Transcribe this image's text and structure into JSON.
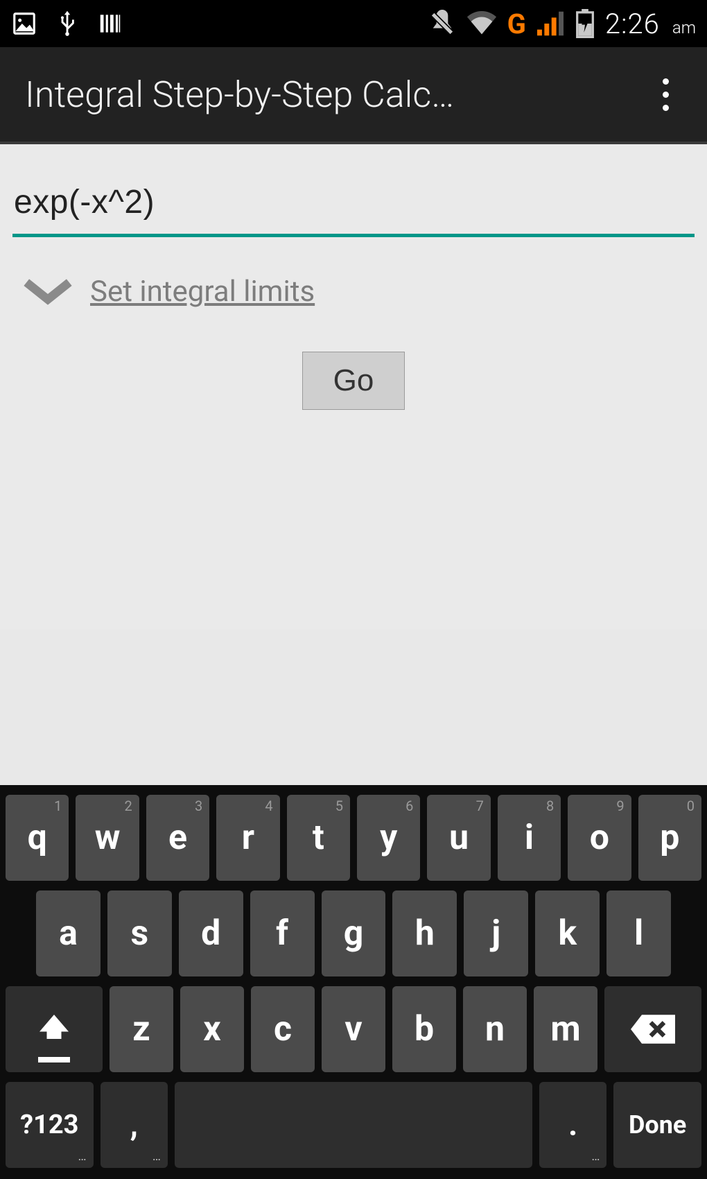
{
  "status": {
    "network_label": "G",
    "time": "2:26",
    "ampm": "am"
  },
  "app": {
    "title": "Integral Step-by-Step Calc…"
  },
  "main": {
    "input_value": "exp(-x^2)",
    "limits_label": "Set integral limits",
    "go_label": "Go"
  },
  "keyboard": {
    "row1": [
      {
        "main": "q",
        "hint": "1"
      },
      {
        "main": "w",
        "hint": "2"
      },
      {
        "main": "e",
        "hint": "3"
      },
      {
        "main": "r",
        "hint": "4"
      },
      {
        "main": "t",
        "hint": "5"
      },
      {
        "main": "y",
        "hint": "6"
      },
      {
        "main": "u",
        "hint": "7"
      },
      {
        "main": "i",
        "hint": "8"
      },
      {
        "main": "o",
        "hint": "9"
      },
      {
        "main": "p",
        "hint": "0"
      }
    ],
    "row2": [
      "a",
      "s",
      "d",
      "f",
      "g",
      "h",
      "j",
      "k",
      "l"
    ],
    "row3": [
      "z",
      "x",
      "c",
      "v",
      "b",
      "n",
      "m"
    ],
    "sym_label": "?123",
    "comma": ",",
    "period": ".",
    "done_label": "Done"
  }
}
